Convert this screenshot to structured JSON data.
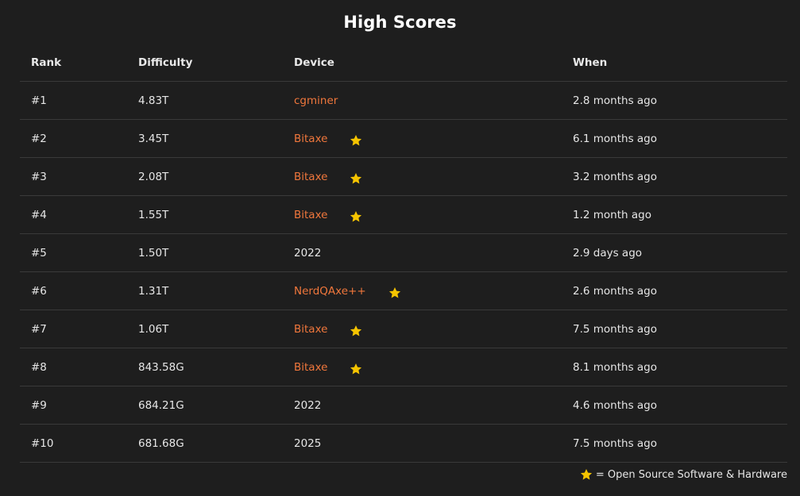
{
  "title": "High Scores",
  "columns": {
    "rank": "Rank",
    "difficulty": "Difficulty",
    "device": "Device",
    "when": "When"
  },
  "rows": [
    {
      "rank": "#1",
      "difficulty": "4.83T",
      "device": "cgminer",
      "when": "2.8 months ago",
      "link": true,
      "open_source": false
    },
    {
      "rank": "#2",
      "difficulty": "3.45T",
      "device": "Bitaxe",
      "when": "6.1 months ago",
      "link": true,
      "open_source": true
    },
    {
      "rank": "#3",
      "difficulty": "2.08T",
      "device": "Bitaxe",
      "when": "3.2 months ago",
      "link": true,
      "open_source": true
    },
    {
      "rank": "#4",
      "difficulty": "1.55T",
      "device": "Bitaxe",
      "when": "1.2 month ago",
      "link": true,
      "open_source": true
    },
    {
      "rank": "#5",
      "difficulty": "1.50T",
      "device": "2022",
      "when": "2.9 days ago",
      "link": false,
      "open_source": false
    },
    {
      "rank": "#6",
      "difficulty": "1.31T",
      "device": "NerdQAxe++",
      "when": "2.6 months ago",
      "link": true,
      "open_source": true
    },
    {
      "rank": "#7",
      "difficulty": "1.06T",
      "device": "Bitaxe",
      "when": "7.5 months ago",
      "link": true,
      "open_source": true
    },
    {
      "rank": "#8",
      "difficulty": "843.58G",
      "device": "Bitaxe",
      "when": "8.1 months ago",
      "link": true,
      "open_source": true
    },
    {
      "rank": "#9",
      "difficulty": "684.21G",
      "device": "2022",
      "when": "4.6 months ago",
      "link": false,
      "open_source": false
    },
    {
      "rank": "#10",
      "difficulty": "681.68G",
      "device": "2025",
      "when": "7.5 months ago",
      "link": false,
      "open_source": false
    }
  ],
  "legend": {
    "text": "= Open Source Software & Hardware",
    "icon": "star-icon"
  },
  "colors": {
    "background": "#1e1e1e",
    "link": "#f0773c",
    "star": "#f5c400",
    "divider": "#3a3a3a"
  }
}
